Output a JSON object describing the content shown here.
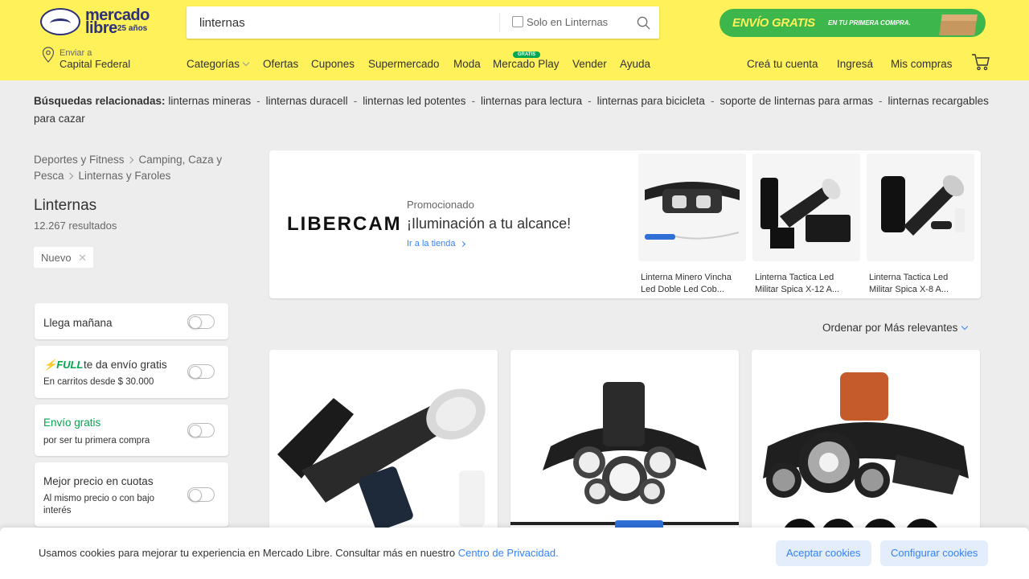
{
  "header": {
    "logo_line1": "mercado",
    "logo_line2": "libre",
    "logo_years": "25 años",
    "search_value": "linternas",
    "search_checkbox_label": "Solo en Linternas",
    "promo_banner_main": "ENVÍO GRATIS",
    "promo_banner_sub": "EN TU PRIMERA COMPRA.",
    "location_small": "Enviar a",
    "location_big": "Capital Federal",
    "nav": [
      "Categorías",
      "Ofertas",
      "Cupones",
      "Supermercado",
      "Moda",
      "Mercado Play",
      "Vender",
      "Ayuda"
    ],
    "gratis_badge": "GRATIS",
    "right_nav": [
      "Creá tu cuenta",
      "Ingresá",
      "Mis compras"
    ]
  },
  "related": {
    "label": "Búsquedas relacionadas:",
    "items": [
      "linternas mineras",
      "linternas duracell",
      "linternas led potentes",
      "linternas para lectura",
      "linternas para bicicleta",
      "soporte de linternas para armas",
      "linternas recargables para cazar"
    ]
  },
  "breadcrumb": [
    "Deportes y Fitness",
    "Camping, Caza y Pesca",
    "Linternas y Faroles"
  ],
  "page": {
    "title": "Linternas",
    "count": "12.267 resultados",
    "chip": "Nuevo"
  },
  "filters": [
    {
      "title": "Llega mañana",
      "sub": ""
    },
    {
      "title": "te da envío gratis",
      "brand": "FULL",
      "sub": "En carritos desde $ 30.000"
    },
    {
      "title": "Envío gratis",
      "sub": "por ser tu primera compra"
    },
    {
      "title": "Mejor precio en cuotas",
      "sub": "Al mismo precio o con bajo interés"
    }
  ],
  "promoted": {
    "brand": "LIBERCAM",
    "label": "Promocionado",
    "headline": "¡Iluminación a tu alcance!",
    "link": "Ir a la tienda",
    "products": [
      {
        "name": "Linterna Minero Vincha Led Doble Led Cob..."
      },
      {
        "name": "Linterna Tactica Led Militar Spica X-12 A..."
      },
      {
        "name": "Linterna Tactica Led Militar Spica X-8 A..."
      }
    ]
  },
  "sort": {
    "label": "Ordenar por",
    "value": "Más relevantes"
  },
  "cookie": {
    "text": "Usamos cookies para mejorar tu experiencia en Mercado Libre. Consultar más en nuestro ",
    "link": "Centro de Privacidad.",
    "accept": "Aceptar cookies",
    "configure": "Configurar cookies"
  },
  "colors": {
    "header_bg": "#fff159",
    "accent_blue": "#3483fa",
    "green": "#00a650",
    "logo_blue": "#2d3277"
  }
}
